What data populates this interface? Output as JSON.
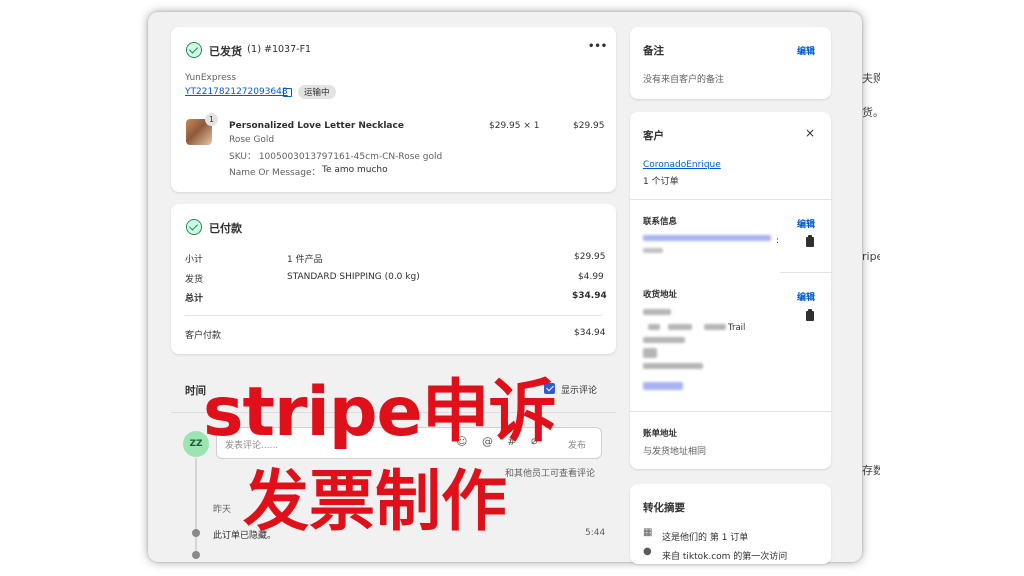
{
  "right_edge_fragments": [
    "夫购",
    "货。",
    "ripe",
    "存数"
  ],
  "fulfillment": {
    "title": "已发货",
    "count": "(1)",
    "order_id": "#1037-F1",
    "more": "•••",
    "carrier": "YunExpress",
    "tracking_number": "YT2217821272093648",
    "status_pill": "运输中",
    "item": {
      "qty_badge": "1",
      "name": "Personalized Love Letter Necklace",
      "variant": "Rose Gold",
      "sku": "SKU： 1005003013797161-45cm-CN-Rose gold",
      "message_label": "Name Or Message：",
      "message_value": "Te amo mucho",
      "unit_price": "$29.95 × 1",
      "total": "$29.95"
    }
  },
  "payment": {
    "title": "已付款",
    "rows": [
      {
        "label": "小计",
        "desc": "1 件产品",
        "amount": "$29.95"
      },
      {
        "label": "发货",
        "desc": "STANDARD SHIPPING (0.0 kg)",
        "amount": "$4.99"
      },
      {
        "label": "总计",
        "desc": "",
        "amount": "$34.94"
      }
    ],
    "paid_label": "客户付款",
    "paid_amount": "$34.94"
  },
  "timeline": {
    "title": "时间",
    "show_comments": "显示评论",
    "avatar_initials": "ZZ",
    "comment_placeholder": "发表评论......",
    "post_button": "发布",
    "visibility_note": "和其他员工可查看评论",
    "date_label": "昨天",
    "event_text": "此订单已隐藏。",
    "event_time": "5:44"
  },
  "notes": {
    "title": "备注",
    "edit": "编辑",
    "body": "没有来自客户的备注"
  },
  "customer": {
    "title": "客户",
    "close": "×",
    "name": "CoronadoEnrique",
    "orders": "1 个订单",
    "contact_title": "联系信息",
    "contact_edit": "编辑",
    "contact_colon": ":",
    "shipping_title": "收货地址",
    "shipping_edit": "编辑",
    "shipping_fragment": "Trail",
    "billing_title": "账单地址",
    "billing_body": "与发货地址相同"
  },
  "conversion": {
    "title": "转化摘要",
    "line1": "这是他们的 第 1 订单",
    "line2": "来自 tiktok.com 的第一次访问"
  },
  "overlay": {
    "line1": "stripe申诉",
    "line2": "发票制作",
    "color": "#e0101b"
  }
}
